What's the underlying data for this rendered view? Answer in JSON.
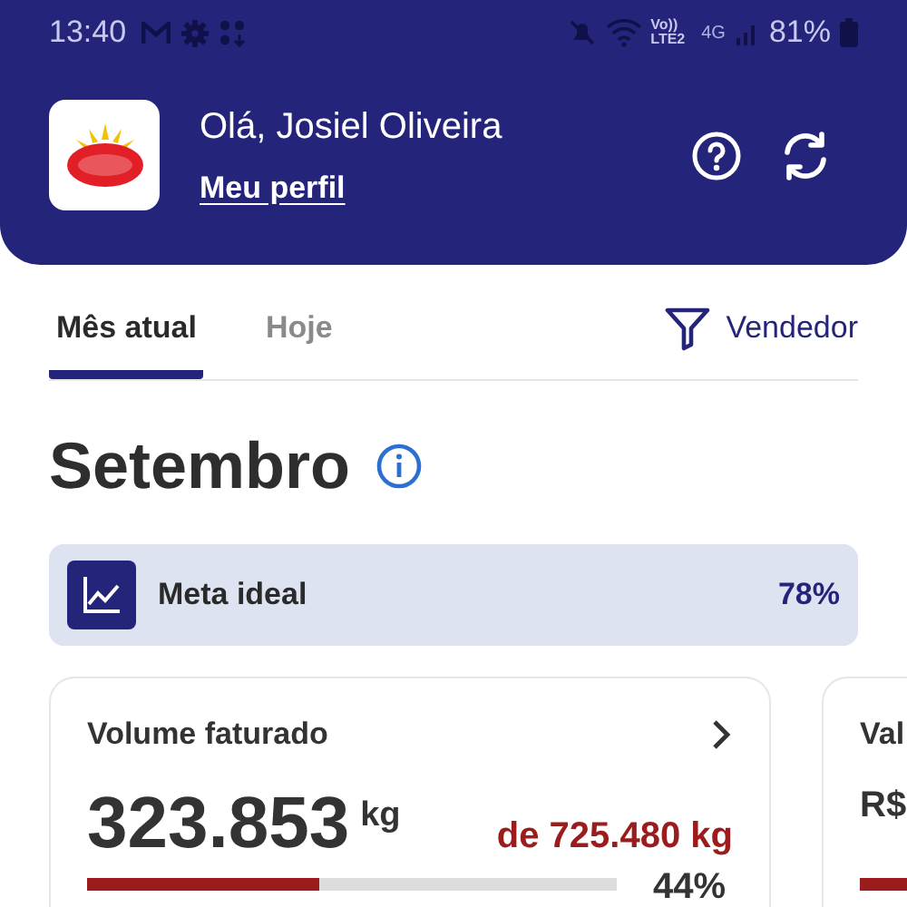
{
  "status_bar": {
    "time": "13:40",
    "network_label": "Vo))\nLTE2",
    "network_type": "4G",
    "battery": "81%"
  },
  "header": {
    "greeting": "Olá, Josiel Oliveira",
    "profile_link": "Meu perfil"
  },
  "tabs": [
    {
      "label": "Mês atual",
      "selected": true
    },
    {
      "label": "Hoje",
      "selected": false
    }
  ],
  "filter_button": {
    "label": "Vendedor"
  },
  "month_title": "Setembro",
  "meta": {
    "label": "Meta ideal",
    "value": "78%"
  },
  "cards": [
    {
      "title": "Volume faturado",
      "value": "323.853",
      "unit": "kg",
      "target": "de 725.480 kg",
      "level": 0.44,
      "percent": "44%"
    },
    {
      "title": "Val",
      "value": "R$"
    }
  ]
}
